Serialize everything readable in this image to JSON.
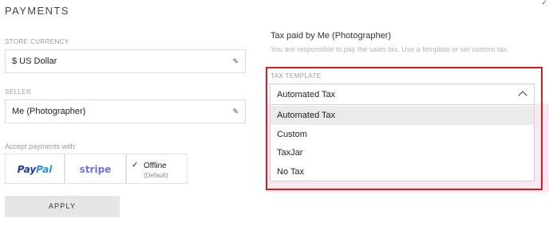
{
  "page": {
    "title": "PAYMENTS",
    "corner_mark": "✓"
  },
  "store_currency": {
    "label": "STORE CURRENCY",
    "value": "$ US Dollar"
  },
  "seller": {
    "label": "SELLER",
    "value": "Me (Photographer)"
  },
  "payments": {
    "label": "Accept payments with:",
    "paypal_a": "Pay",
    "paypal_b": "Pal",
    "stripe": "stripe",
    "offline_label": "Offline",
    "offline_sub": "(Default)"
  },
  "apply": {
    "label": "APPLY"
  },
  "tax": {
    "heading": "Tax paid by Me (Photographer)",
    "subtext": "You are responsible to pay the sales tax. Use a template or set custom tax.",
    "template_label": "TAX TEMPLATE",
    "selected": "Automated Tax",
    "options": [
      "Automated Tax",
      "Custom",
      "TaxJar",
      "No Tax"
    ]
  },
  "colors": {
    "highlight": "#cc1f25",
    "paypal_dark": "#1b3f8f",
    "paypal_light": "#2e8fe0",
    "stripe": "#6d74d8"
  },
  "icons": [
    "pencil-icon",
    "check-icon",
    "chevron-up-icon"
  ]
}
